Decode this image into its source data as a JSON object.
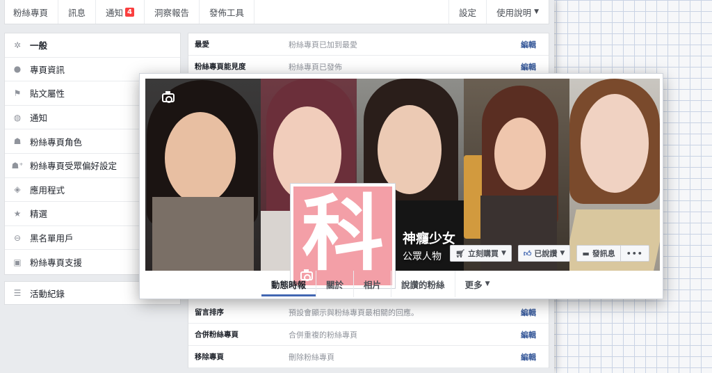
{
  "topnav": {
    "items": [
      "粉絲專頁",
      "訊息",
      "通知",
      "洞察報告",
      "發佈工具"
    ],
    "notification_count": "4",
    "settings": "設定",
    "help": "使用說明"
  },
  "sidebar": {
    "items": [
      {
        "label": "一般",
        "icon": "gear-icon"
      },
      {
        "label": "專頁資訊",
        "icon": "info-icon"
      },
      {
        "label": "貼文屬性",
        "icon": "flag-icon"
      },
      {
        "label": "通知",
        "icon": "globe-icon"
      },
      {
        "label": "粉絲專頁角色",
        "icon": "person-icon"
      },
      {
        "label": "粉絲專頁受眾偏好設定",
        "icon": "person-plus-icon"
      },
      {
        "label": "應用程式",
        "icon": "cube-icon"
      },
      {
        "label": "精選",
        "icon": "star-icon"
      },
      {
        "label": "黑名單用戶",
        "icon": "block-icon"
      },
      {
        "label": "粉絲專頁支援",
        "icon": "facebook-icon"
      }
    ],
    "activity": {
      "label": "活動紀錄",
      "icon": "list-icon"
    }
  },
  "settings_table": {
    "edit_label": "編輯",
    "rows": [
      {
        "label": "最愛",
        "value": "粉絲專頁已加到最愛"
      },
      {
        "label": "粉絲專頁能見度",
        "value": "粉絲專頁已發佈"
      },
      {
        "label": "留言排序",
        "value": "預設會顯示與粉絲專頁最相關的回應。"
      },
      {
        "label": "合併粉絲專頁",
        "value": "合併重複的粉絲專頁"
      },
      {
        "label": "移除專頁",
        "value": "刪除粉絲專頁"
      }
    ]
  },
  "page_card": {
    "profile_glyph": "科",
    "page_name": "神癮少女",
    "page_category": "公眾人物",
    "buttons": {
      "shop": "立刻購買",
      "liked": "已說讚",
      "message": "發訊息",
      "more": "•••"
    },
    "tabs": [
      "動態時報",
      "關於",
      "相片",
      "說讚的粉絲",
      "更多"
    ],
    "profile_color": "#f39fa7",
    "accent_color": "#4267b2"
  }
}
